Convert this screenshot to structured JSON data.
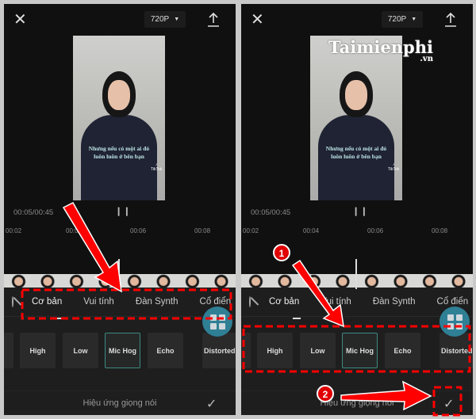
{
  "panels": [
    {
      "close_icon": "close-icon",
      "resolution": "720P",
      "upload_icon": "upload-icon",
      "video_caption": [
        "Nhưng nếu có một ai đó",
        "luôn luôn ở bên bạn"
      ],
      "video_logo": "TikTok",
      "time": "00:05/00:45",
      "ruler_ticks": [
        "00:02",
        "00:04",
        "00:06",
        "00:08"
      ],
      "tabs": [
        "Cơ bản",
        "Vui tính",
        "Đàn Synth",
        "Cổ điển"
      ],
      "active_tab": "Cơ bản",
      "effects": [
        "High",
        "Low",
        "Mic Hog",
        "Echo",
        "Distorted"
      ],
      "selected_effect": "Mic Hog",
      "bottom_label": "Hiệu ứng giọng nói"
    },
    {
      "close_icon": "close-icon",
      "resolution": "720P",
      "upload_icon": "upload-icon",
      "video_caption": [
        "Nhưng nếu có một ai đó",
        "luôn luôn ở bên bạn"
      ],
      "video_logo": "TikTok",
      "time": "00:05/00:45",
      "ruler_ticks": [
        "00:02",
        "00:04",
        "00:06",
        "00:08"
      ],
      "tabs": [
        "Cơ bản",
        "Vui tính",
        "Đàn Synth",
        "Cổ điển"
      ],
      "active_tab": "Cơ bản",
      "effects": [
        "High",
        "Low",
        "Mic Hog",
        "Echo",
        "Distorted"
      ],
      "selected_effect": "Mic Hog",
      "bottom_label": "Hiệu ứng giọng nói"
    }
  ],
  "watermark": {
    "brand": "Taimienphi",
    "suffix": ".vn"
  },
  "annotations": {
    "step1": "1",
    "step2": "2",
    "color": "#ff0000"
  },
  "colors": {
    "accent_selected": "#3d8a80",
    "fab": "#2f7f95"
  }
}
